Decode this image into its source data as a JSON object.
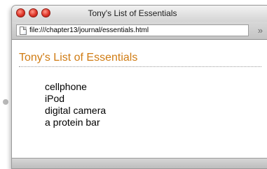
{
  "window": {
    "title": "Tony's List of Essentials"
  },
  "toolbar": {
    "address": "file:///chapter13/journal/essentials.html",
    "overflow": "»"
  },
  "page": {
    "heading": "Tony's List of Essentials",
    "items": [
      {
        "label": "cellphone"
      },
      {
        "label": "iPod"
      },
      {
        "label": "digital camera"
      },
      {
        "label": "a protein bar"
      }
    ]
  },
  "colors": {
    "heading": "#d07c14",
    "close_button": "#e0362a"
  }
}
